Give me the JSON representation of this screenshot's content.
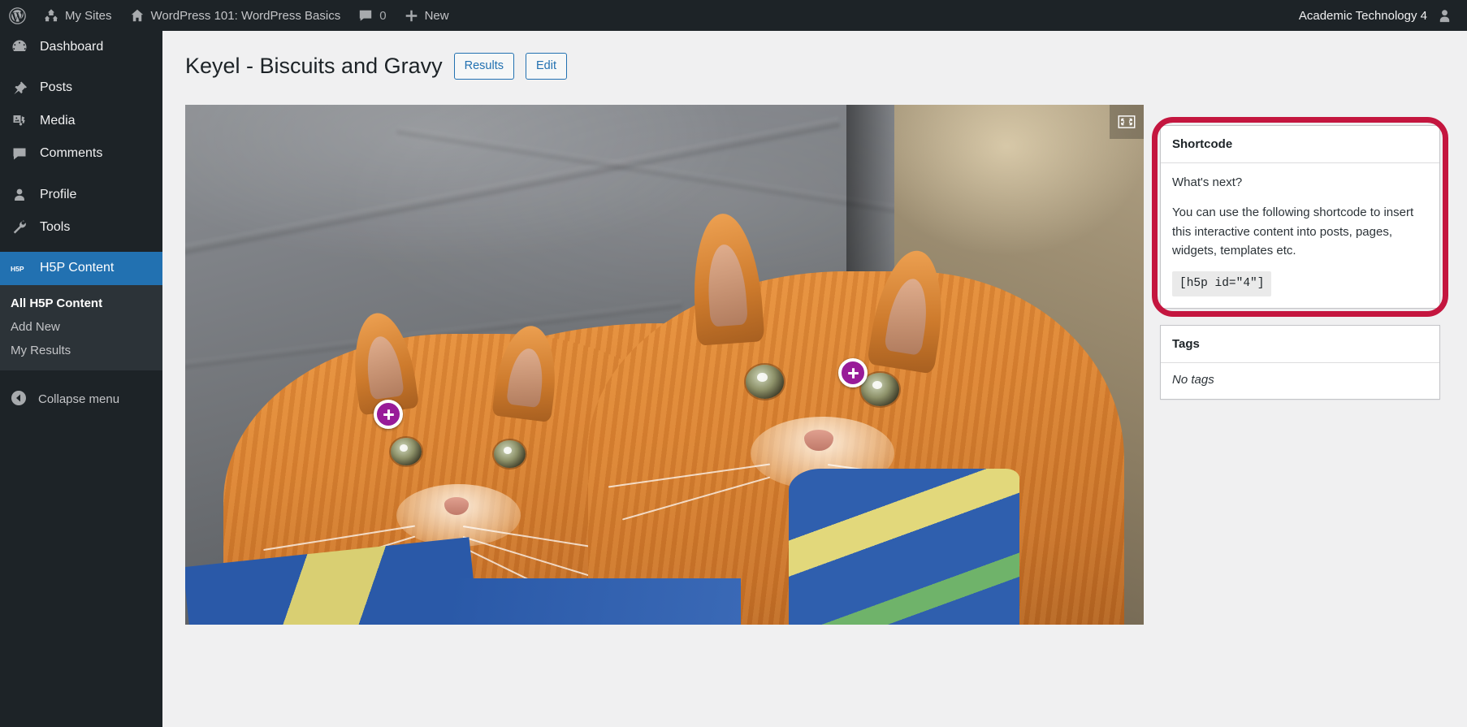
{
  "adminbar": {
    "left_items": [
      {
        "name": "wordpress-logo",
        "icon": "wordpress-icon",
        "label": ""
      },
      {
        "name": "my-sites",
        "icon": "sites-icon",
        "label": "My Sites"
      },
      {
        "name": "site-name",
        "icon": "home-icon",
        "label": "WordPress 101: WordPress Basics"
      },
      {
        "name": "comments",
        "icon": "comment-bubble-icon",
        "label": "0"
      },
      {
        "name": "new-content",
        "icon": "plus-icon",
        "label": "New"
      }
    ],
    "account": {
      "label": "Academic Technology 4",
      "icon": "user-avatar-icon"
    }
  },
  "sidebar": {
    "items": [
      {
        "label": "Dashboard",
        "icon": "dashboard-icon",
        "current": false,
        "gap_after": true
      },
      {
        "label": "Posts",
        "icon": "pin-icon",
        "current": false
      },
      {
        "label": "Media",
        "icon": "media-icon",
        "current": false
      },
      {
        "label": "Comments",
        "icon": "comment-icon",
        "current": false,
        "gap_after": true
      },
      {
        "label": "Profile",
        "icon": "user-icon",
        "current": false
      },
      {
        "label": "Tools",
        "icon": "wrench-icon",
        "current": false,
        "gap_after": true
      },
      {
        "label": "H5P Content",
        "icon": "h5p-icon",
        "current": true
      }
    ],
    "submenu": [
      {
        "label": "All H5P Content",
        "current": true
      },
      {
        "label": "Add New",
        "current": false
      },
      {
        "label": "My Results",
        "current": false
      }
    ],
    "collapse": {
      "label": "Collapse menu",
      "icon": "collapse-arrow-icon"
    },
    "active_color": "#2271b1"
  },
  "page": {
    "title": "Keyel - Biscuits and Gravy",
    "buttons": [
      {
        "label": "Results",
        "name": "results-button"
      },
      {
        "label": "Edit",
        "name": "edit-button"
      }
    ]
  },
  "player": {
    "fullscreen_icon": "fullscreen-icon",
    "hotspots": [
      {
        "name": "hotspot-1",
        "icon": "plus-icon",
        "label": "+"
      },
      {
        "name": "hotspot-2",
        "icon": "plus-icon",
        "label": "+"
      }
    ],
    "hotspot_color": "#981b98",
    "alt": "Two orange tabby cats lying together on a grey couch with a blue and yellow quilt"
  },
  "shortcode_panel": {
    "title": "Shortcode",
    "intro": "What's next?",
    "description": "You can use the following shortcode to insert this interactive content into posts, pages, widgets, templates etc.",
    "shortcode": "[h5p id=\"4\"]",
    "highlight_color": "#c4163f",
    "highlighted": true
  },
  "tags_panel": {
    "title": "Tags",
    "empty_text": "No tags"
  }
}
